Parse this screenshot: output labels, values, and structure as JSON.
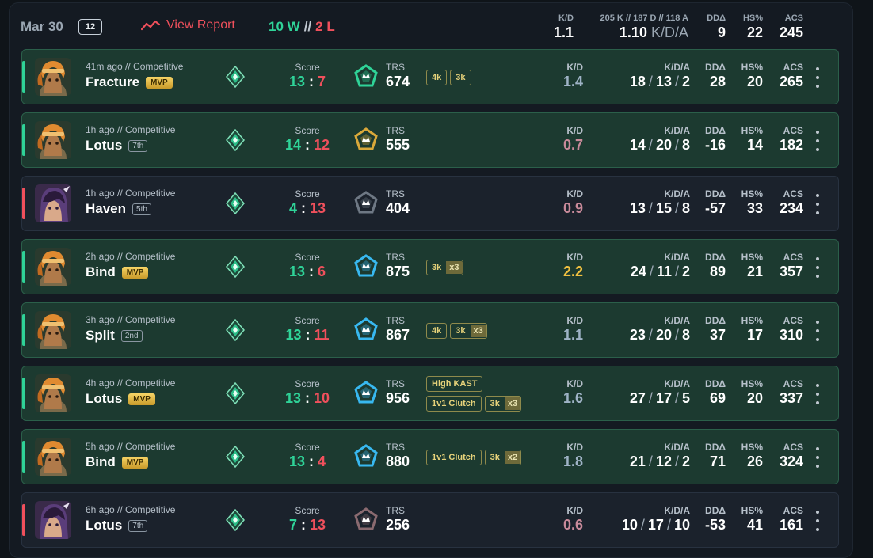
{
  "header": {
    "date": "Mar 30",
    "count": "12",
    "view_report": "View Report",
    "wins": "10 W",
    "sep": "//",
    "losses": "2 L",
    "kd_label": "K/D",
    "kd_value": "1.1",
    "kda_label": "205 K // 187 D // 118 A",
    "kda_value": "1.10",
    "kda_suffix": "K/D/A",
    "dd_label": "DDΔ",
    "dd_value": "9",
    "hs_label": "HS%",
    "hs_value": "22",
    "acs_label": "ACS",
    "acs_value": "245"
  },
  "labels": {
    "score": "Score",
    "trs": "TRS",
    "kd": "K/D",
    "kda": "K/D/A",
    "dd": "DDΔ",
    "hs": "HS%",
    "acs": "ACS"
  },
  "matches": [
    {
      "result": "win",
      "agent": "orange",
      "time": "41m ago // Competitive",
      "map": "Fracture",
      "tag": "MVP",
      "score_us": "13",
      "score_sep": ":",
      "score_them": "7",
      "trs_color": "#2fd398",
      "trs": "674",
      "badges": [
        {
          "t": "4k"
        },
        {
          "t": "3k"
        }
      ],
      "kd": "1.4",
      "kd_color": "#9fb3c6",
      "k": "18",
      "d": "13",
      "a": "2",
      "dd": "28",
      "hs": "20",
      "acs": "265"
    },
    {
      "result": "win",
      "agent": "orange",
      "time": "1h ago // Competitive",
      "map": "Lotus",
      "tag": "7th",
      "score_us": "14",
      "score_sep": ":",
      "score_them": "12",
      "trs_color": "#d9a83a",
      "trs": "555",
      "badges": [],
      "kd": "0.7",
      "kd_color": "#c88a9a",
      "k": "14",
      "d": "20",
      "a": "8",
      "dd": "-16",
      "hs": "14",
      "acs": "182"
    },
    {
      "result": "loss",
      "agent": "purple",
      "time": "1h ago // Competitive",
      "map": "Haven",
      "tag": "5th",
      "score_us": "4",
      "score_sep": ":",
      "score_them": "13",
      "trs_color": "#6e7884",
      "trs": "404",
      "badges": [],
      "kd": "0.9",
      "kd_color": "#c88a9a",
      "k": "13",
      "d": "15",
      "a": "8",
      "dd": "-57",
      "hs": "33",
      "acs": "234"
    },
    {
      "result": "win",
      "agent": "orange",
      "time": "2h ago // Competitive",
      "map": "Bind",
      "tag": "MVP",
      "score_us": "13",
      "score_sep": ":",
      "score_them": "6",
      "trs_color": "#38b8f0",
      "trs": "875",
      "badges": [
        {
          "t": "3k",
          "x": "x3"
        }
      ],
      "kd": "2.2",
      "kd_color": "#f0c040",
      "k": "24",
      "d": "11",
      "a": "2",
      "dd": "89",
      "hs": "21",
      "acs": "357"
    },
    {
      "result": "win",
      "agent": "orange",
      "time": "3h ago // Competitive",
      "map": "Split",
      "tag": "2nd",
      "score_us": "13",
      "score_sep": ":",
      "score_them": "11",
      "trs_color": "#38b8f0",
      "trs": "867",
      "badges": [
        {
          "t": "4k"
        },
        {
          "t": "3k",
          "x": "x3"
        }
      ],
      "kd": "1.1",
      "kd_color": "#9fb3c6",
      "k": "23",
      "d": "20",
      "a": "8",
      "dd": "37",
      "hs": "17",
      "acs": "310"
    },
    {
      "result": "win",
      "agent": "orange",
      "time": "4h ago // Competitive",
      "map": "Lotus",
      "tag": "MVP",
      "score_us": "13",
      "score_sep": ":",
      "score_them": "10",
      "trs_color": "#38b8f0",
      "trs": "956",
      "badges2": [
        [
          {
            "t": "High KAST"
          }
        ],
        [
          {
            "t": "1v1 Clutch"
          },
          {
            "t": "3k",
            "x": "x3"
          }
        ]
      ],
      "kd": "1.6",
      "kd_color": "#9fb3c6",
      "k": "27",
      "d": "17",
      "a": "5",
      "dd": "69",
      "hs": "20",
      "acs": "337"
    },
    {
      "result": "win",
      "agent": "orange",
      "time": "5h ago // Competitive",
      "map": "Bind",
      "tag": "MVP",
      "score_us": "13",
      "score_sep": ":",
      "score_them": "4",
      "trs_color": "#38b8f0",
      "trs": "880",
      "badges": [
        {
          "t": "1v1 Clutch"
        },
        {
          "t": "3k",
          "x": "x2"
        }
      ],
      "kd": "1.8",
      "kd_color": "#9fb3c6",
      "k": "21",
      "d": "12",
      "a": "2",
      "dd": "71",
      "hs": "26",
      "acs": "324"
    },
    {
      "result": "loss",
      "agent": "purple",
      "time": "6h ago // Competitive",
      "map": "Lotus",
      "tag": "7th",
      "score_us": "7",
      "score_sep": ":",
      "score_them": "13",
      "trs_color": "#8a6a70",
      "trs": "256",
      "badges": [],
      "kd": "0.6",
      "kd_color": "#c88a9a",
      "k": "10",
      "d": "17",
      "a": "10",
      "dd": "-53",
      "hs": "41",
      "acs": "161"
    }
  ]
}
